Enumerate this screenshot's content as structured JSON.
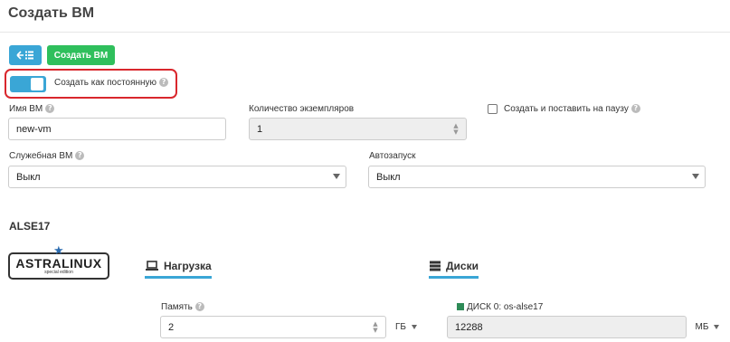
{
  "page": {
    "title": "Создать ВМ"
  },
  "toolbar": {
    "back_icon": "back-list-icon",
    "create_label": "Создать ВМ"
  },
  "persistent": {
    "label": "Создать как постоянную",
    "enabled": true
  },
  "vm_name": {
    "label": "Имя ВМ",
    "value": "new-vm"
  },
  "instances": {
    "label": "Количество экземпляров",
    "value": "1"
  },
  "pause": {
    "label": "Создать и поставить на паузу",
    "checked": false
  },
  "service_vm": {
    "label": "Служебная ВМ",
    "value": "Выкл"
  },
  "autostart": {
    "label": "Автозапуск",
    "value": "Выкл"
  },
  "template": {
    "name": "ALSE17",
    "logo_text": "ASTRALINUX",
    "logo_subtext": "special edition"
  },
  "tabs": [
    {
      "label": "Нагрузка",
      "icon": "laptop-icon"
    },
    {
      "label": "Диски",
      "icon": "server-stack-icon"
    }
  ],
  "memory": {
    "label": "Память",
    "value": "2",
    "unit": "ГБ"
  },
  "disk": {
    "label": "ДИСК 0: os-alse17",
    "value": "12288",
    "unit": "МБ",
    "status_color": "#2e8b57"
  },
  "colors": {
    "accent": "#3aa6d6",
    "success": "#2fbf5c",
    "highlight": "#d9272d"
  }
}
